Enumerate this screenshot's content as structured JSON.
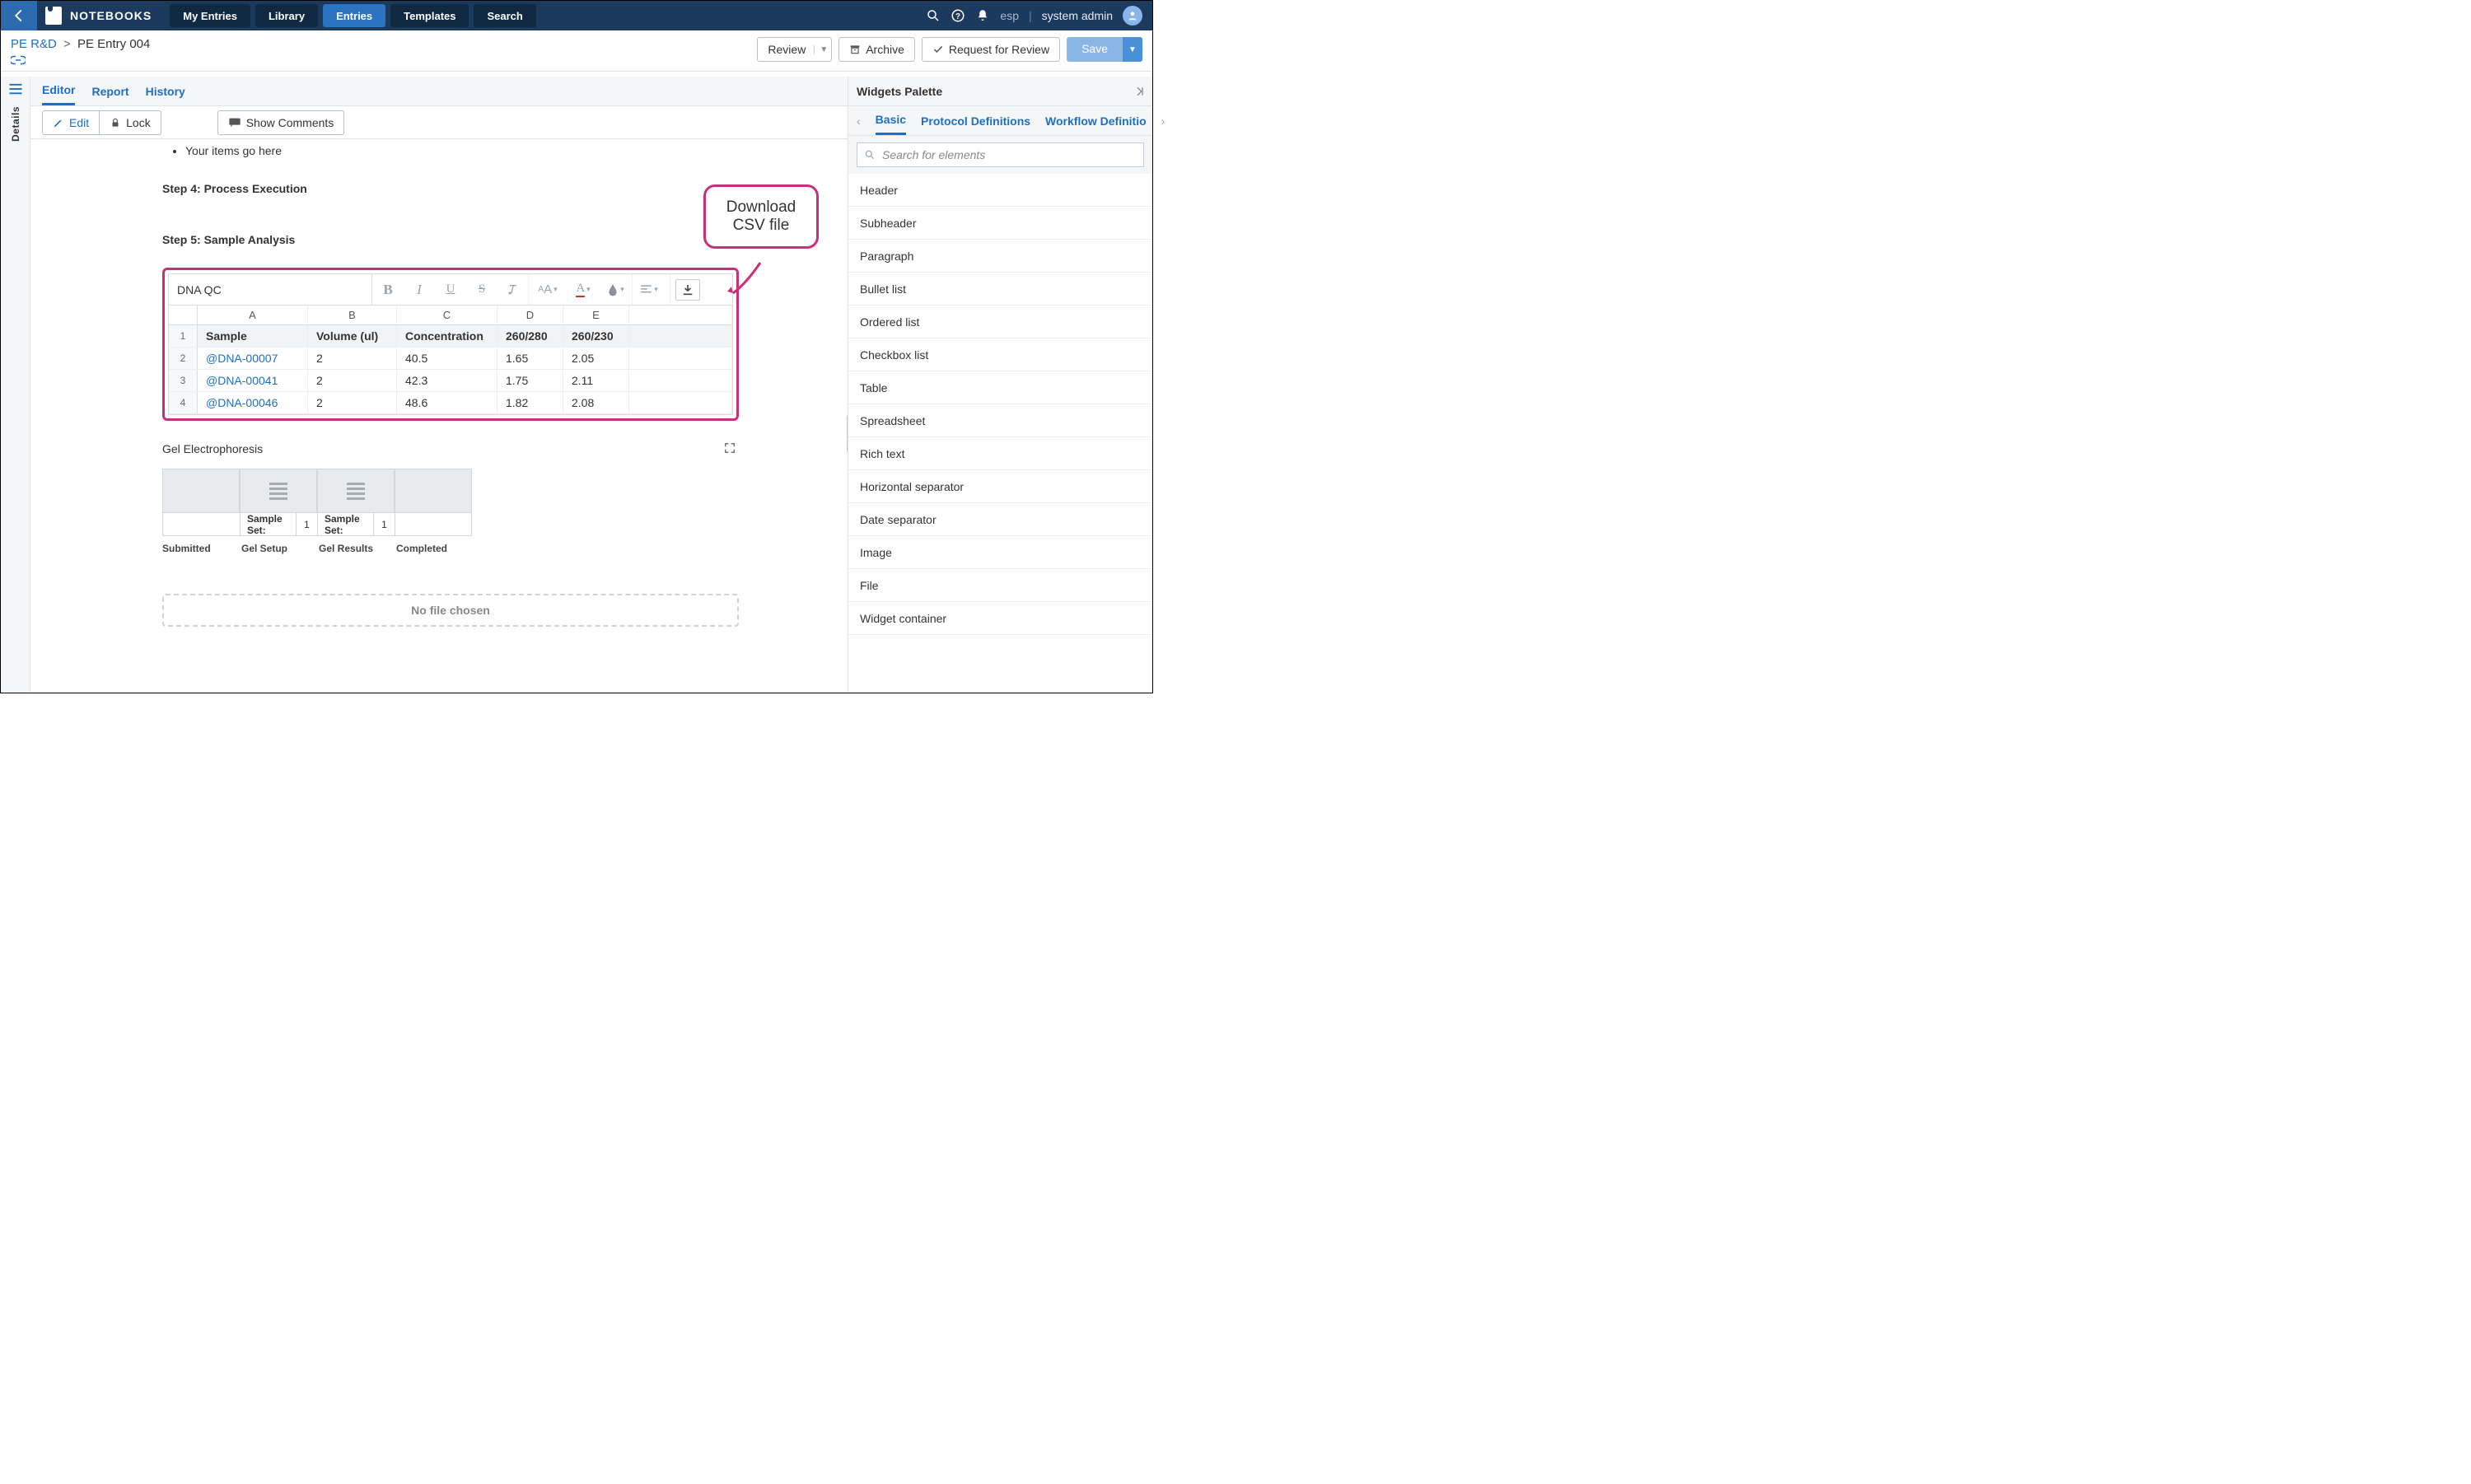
{
  "topbar": {
    "brand": "NOTEBOOKS",
    "tabs": [
      "My Entries",
      "Library",
      "Entries",
      "Templates",
      "Search"
    ],
    "active_tab": 2,
    "user_short": "esp",
    "user_full": "system admin"
  },
  "breadcrumb": {
    "root": "PE R&D",
    "sep": ">",
    "leaf": "PE Entry 004"
  },
  "actions": {
    "review": "Review",
    "archive": "Archive",
    "request_review": "Request for Review",
    "save": "Save"
  },
  "leftrail": {
    "label": "Details"
  },
  "editor_tabs": {
    "items": [
      "Editor",
      "Report",
      "History"
    ],
    "active": 0
  },
  "toolbar": {
    "edit": "Edit",
    "lock": "Lock",
    "show_comments": "Show Comments"
  },
  "canvas": {
    "bullet_placeholder": "Your items go here",
    "step4_title": "Step 4: Process Execution",
    "step5_title": "Step 5: Sample Analysis",
    "callout_l1": "Download",
    "callout_l2": "CSV file",
    "spreadsheet": {
      "title": "DNA QC",
      "col_letters": [
        "A",
        "B",
        "C",
        "D",
        "E"
      ],
      "headers": [
        "Sample",
        "Volume (ul)",
        "Concentration",
        "260/280",
        "260/230"
      ],
      "rows": [
        {
          "n": "2",
          "sample": "@DNA-00007",
          "vol": "2",
          "conc": "40.5",
          "r1": "1.65",
          "r2": "2.05"
        },
        {
          "n": "3",
          "sample": "@DNA-00041",
          "vol": "2",
          "conc": "42.3",
          "r1": "1.75",
          "r2": "2.11"
        },
        {
          "n": "4",
          "sample": "@DNA-00046",
          "vol": "2",
          "conc": "48.6",
          "r1": "1.82",
          "r2": "2.08"
        }
      ]
    },
    "gel_title": "Gel Electrophoresis",
    "gel": {
      "sample_set_label": "Sample Set:",
      "counts": [
        "1",
        "1"
      ],
      "phases": [
        "Submitted",
        "Gel Setup",
        "Gel Results",
        "Completed"
      ]
    },
    "dropzone": "No file chosen"
  },
  "palette": {
    "title": "Widgets Palette",
    "tabs": [
      "Basic",
      "Protocol Definitions",
      "Workflow Definitio"
    ],
    "active": 0,
    "search_placeholder": "Search for elements",
    "items": [
      "Header",
      "Subheader",
      "Paragraph",
      "Bullet list",
      "Ordered list",
      "Checkbox list",
      "Table",
      "Spreadsheet",
      "Rich text",
      "Horizontal separator",
      "Date separator",
      "Image",
      "File",
      "Widget container"
    ]
  }
}
